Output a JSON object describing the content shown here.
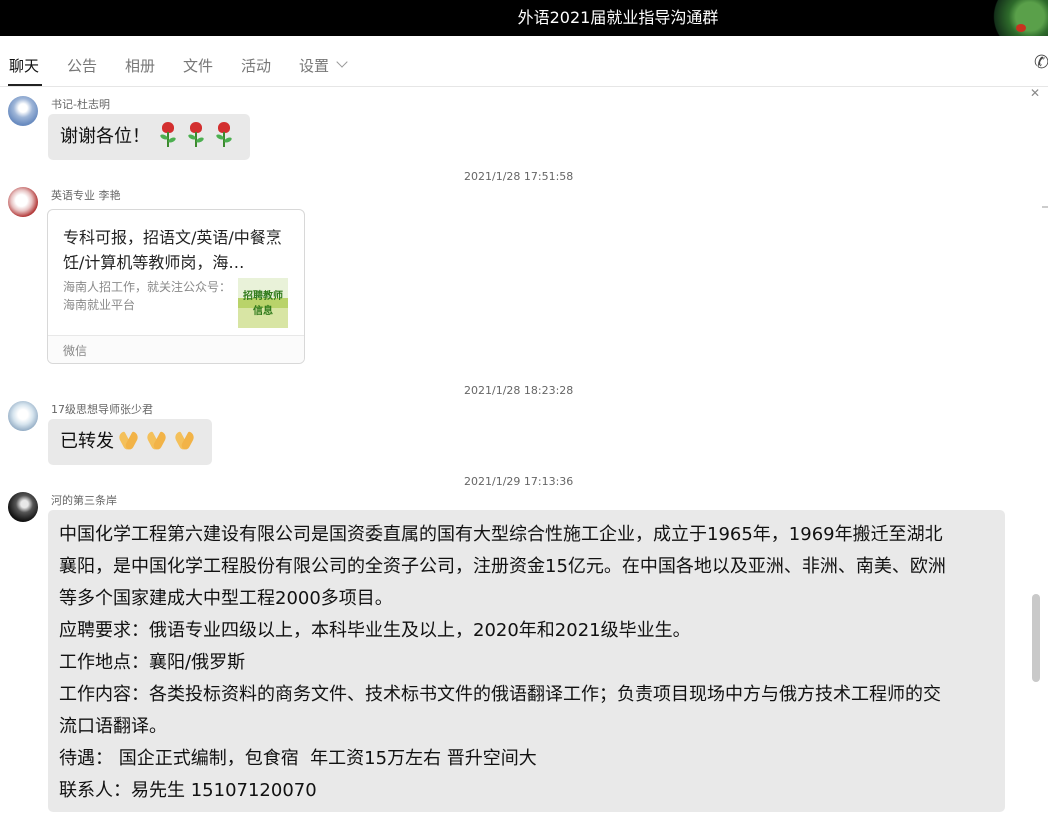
{
  "window": {
    "title": "外语2021届就业指导沟通群"
  },
  "tabs": [
    {
      "label": "聊天",
      "active": true
    },
    {
      "label": "公告"
    },
    {
      "label": "相册"
    },
    {
      "label": "文件"
    },
    {
      "label": "活动"
    },
    {
      "label": "设置"
    }
  ],
  "icons": {
    "phone": "phone-icon",
    "close": "close-icon",
    "settings_dropdown": "chevron-down-icon",
    "reaction_rose": "rose-emoji",
    "reaction_pray": "pray-emoji"
  },
  "messages": [
    {
      "sender": "书记-杜志明",
      "text": "谢谢各位！",
      "emoji": "rose",
      "emoji_count": 3
    },
    {
      "time": "2021/1/28 17:51:58"
    },
    {
      "sender": "英语专业 李艳",
      "card": {
        "title": "专科可报，招语文/英语/中餐烹饪/计算机等教师岗，海…",
        "description": "海南人招工作，就关注公众号：海南就业平台",
        "thumb_text": "招聘教师信息",
        "source": "微信"
      }
    },
    {
      "time": "2021/1/28 18:23:28"
    },
    {
      "sender": "17级思想导师张少君",
      "text": "已转发",
      "emoji": "pray",
      "emoji_count": 3
    },
    {
      "time": "2021/1/29 17:13:36"
    },
    {
      "sender": "河的第三条岸",
      "lines": [
        "中国化学工程第六建设有限公司是国资委直属的国有大型综合性施工企业，成立于1965年，1969年搬迁至湖北",
        "襄阳，是中国化学工程股份有限公司的全资子公司，注册资金15亿元。在中国各地以及亚洲、非洲、南美、欧洲",
        "等多个国家建成大中型工程2000多项目。",
        "应聘要求：俄语专业四级以上，本科毕业生及以上，2020年和2021级毕业生。",
        "工作地点：襄阳/俄罗斯",
        "工作内容：各类投标资料的商务文件、技术标书文件的俄语翻译工作；负责项目现场中方与俄方技术工程师的交",
        "流口语翻译。",
        "待遇： 国企正式编制，包食宿  年工资15万左右 晋升空间大",
        "联系人：易先生 15107120070"
      ]
    }
  ],
  "colors": {
    "titlebar": "#000000",
    "bubble": "#e9e9e9",
    "active_tab": "#111111",
    "inactive_tab": "#777777"
  }
}
